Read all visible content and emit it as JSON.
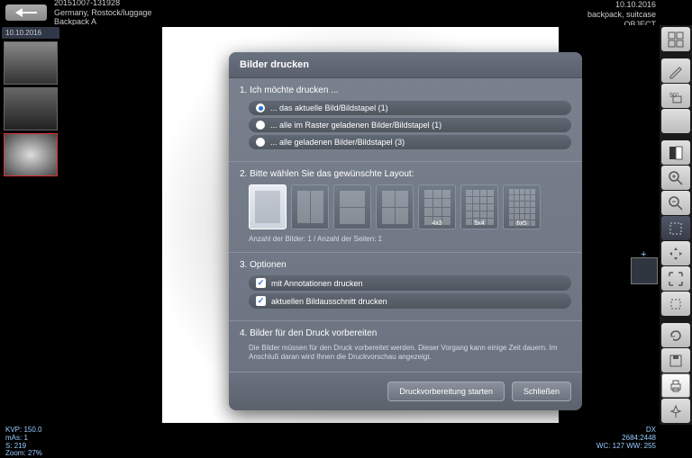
{
  "topbar": {
    "id": "20151007-131928",
    "location": "Germany, Rostock/luggage",
    "subject": "Backpack A",
    "date": "10.10.2016",
    "tags": "backpack, suitcase",
    "type": "OBJECT"
  },
  "thumbs": {
    "date": "10.10.2016"
  },
  "dialog": {
    "title": "Bilder drucken",
    "s1": {
      "head": "1. Ich möchte drucken ...",
      "opts": [
        "... das aktuelle Bild/Bildstapel (1)",
        "... alle im Raster geladenen Bilder/Bildstapel (1)",
        "... alle geladenen Bilder/Bildstapel (3)"
      ],
      "selected": 0
    },
    "s2": {
      "head": "2. Bitte wählen Sie das gewünschte Layout:",
      "layouts": [
        {
          "cols": 1,
          "rows": 1,
          "label": ""
        },
        {
          "cols": 2,
          "rows": 1,
          "label": ""
        },
        {
          "cols": 1,
          "rows": 2,
          "label": ""
        },
        {
          "cols": 2,
          "rows": 2,
          "label": ""
        },
        {
          "cols": 3,
          "rows": 4,
          "label": "4x3"
        },
        {
          "cols": 4,
          "rows": 5,
          "label": "5x4"
        },
        {
          "cols": 5,
          "rows": 6,
          "label": "6x5"
        }
      ],
      "selected": 0,
      "counts": "Anzahl der Bilder: 1  /  Anzahl der Seiten: 1"
    },
    "s3": {
      "head": "3. Optionen",
      "opts": [
        "mit Annotationen drucken",
        "aktuellen Bildausschnitt drucken"
      ],
      "checked": [
        true,
        true
      ]
    },
    "s4": {
      "head": "4. Bilder für den Druck vorbereiten",
      "desc": "Die Bilder müssen für den Druck vorbereitet werden. Dieser Vorgang kann einige Zeit dauern. Im Anschluß daran wird Ihnen die Druckvorschau angezeigt."
    },
    "footer": {
      "start": "Druckvorbereitung starten",
      "close": "Schließen"
    }
  },
  "bottom": {
    "kvp": "KVP: 150.0",
    "mas": "mAs: 1",
    "s": "S: 219",
    "zoom": "Zoom: 27%",
    "mode": "DX",
    "coords": "2684:2448",
    "window": "WC: 127 WW: 255"
  },
  "tools": [
    "grid",
    "pen",
    "rotate",
    "blank",
    "contrast",
    "zoom-in",
    "zoom-out",
    "fit",
    "move",
    "fullscreen",
    "crop",
    "reset",
    "save",
    "print",
    "pin"
  ]
}
